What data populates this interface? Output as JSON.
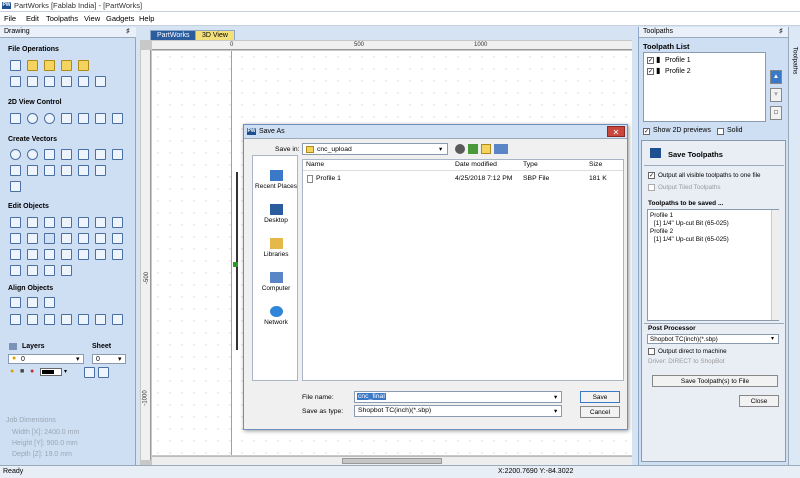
{
  "window": {
    "logo": "PW",
    "title": "PartWorks [Fablab India] - [PartWorks]"
  },
  "menu": [
    "File",
    "Edit",
    "Toolpaths",
    "View",
    "Gadgets",
    "Help"
  ],
  "left_panel": {
    "header": "Drawing",
    "sections": {
      "file_operations": "File Operations",
      "view_control": "2D View Control",
      "create_vectors": "Create Vectors",
      "edit_objects": "Edit Objects",
      "align_objects": "Align Objects",
      "layers": "Layers",
      "sheet": "Sheet"
    },
    "layer_value": "0",
    "sheet_value": "0",
    "job_dimensions": {
      "title": "Job Dimensions",
      "width": "Width  [X]: 2400.0 mm",
      "height": "Height [Y]: 900.0 mm",
      "depth": "Depth  [Z]: 19.0 mm"
    }
  },
  "tabs": {
    "partworks": "PartWorks",
    "view3d": "3D View"
  },
  "rulers": {
    "top": [
      "0",
      "500",
      "1000"
    ],
    "left": [
      "-500",
      "-1000"
    ]
  },
  "right_panel": {
    "header": "Toolpaths",
    "vertical_tab": "Toolpaths",
    "list_title": "Toolpath List",
    "toolpaths": [
      {
        "name": "Profile 1",
        "checked": true
      },
      {
        "name": "Profile 2",
        "checked": true
      }
    ],
    "show_2d_previews": "Show 2D previews",
    "solid": "Solid",
    "save_title": "Save Toolpaths",
    "output_all": "Output all visible toolpaths to one file",
    "output_tiled": "Output Tiled Toolpaths",
    "to_be_saved_title": "Toolpaths to be saved ...",
    "to_be_saved": [
      "Profile 1",
      "   [1]  1/4\" Up-cut Bit (65-025)",
      "Profile 2",
      "   [1]  1/4\" Up-cut Bit (65-025)"
    ],
    "post_processor_title": "Post Processor",
    "post_processor": "Shopbot TC(inch)(*.sbp)",
    "output_direct": "Output direct to machine",
    "driver": "Driver: DIRECT to ShopBot",
    "save_button": "Save Toolpath(s) to File",
    "close_button": "Close"
  },
  "dialog": {
    "logo": "PW",
    "title": "Save As",
    "save_in_label": "Save in:",
    "save_in_value": "cnc_upload",
    "places": [
      "Recent Places",
      "Desktop",
      "Libraries",
      "Computer",
      "Network"
    ],
    "columns": [
      "Name",
      "Date modified",
      "Type",
      "Size"
    ],
    "files": [
      {
        "name": "Profile 1",
        "date": "4/25/2018 7:12 PM",
        "type": "SBP File",
        "size": "181 K"
      }
    ],
    "filename_label": "File name:",
    "filename_value": "cnc_final",
    "savetype_label": "Save as type:",
    "savetype_value": "Shopbot TC(inch)(*.sbp)",
    "save_button": "Save",
    "cancel_button": "Cancel",
    "close_glyph": "✕"
  },
  "status": {
    "left": "Ready",
    "coords": "X:2200.7690 Y:-84.3022"
  },
  "colors": {
    "panel_bg": "#cfdff3",
    "accent": "#1d4f91",
    "close_red": "#c9463d",
    "tab_active": "#2b5c9e",
    "tab_3d": "#f3e07a"
  }
}
